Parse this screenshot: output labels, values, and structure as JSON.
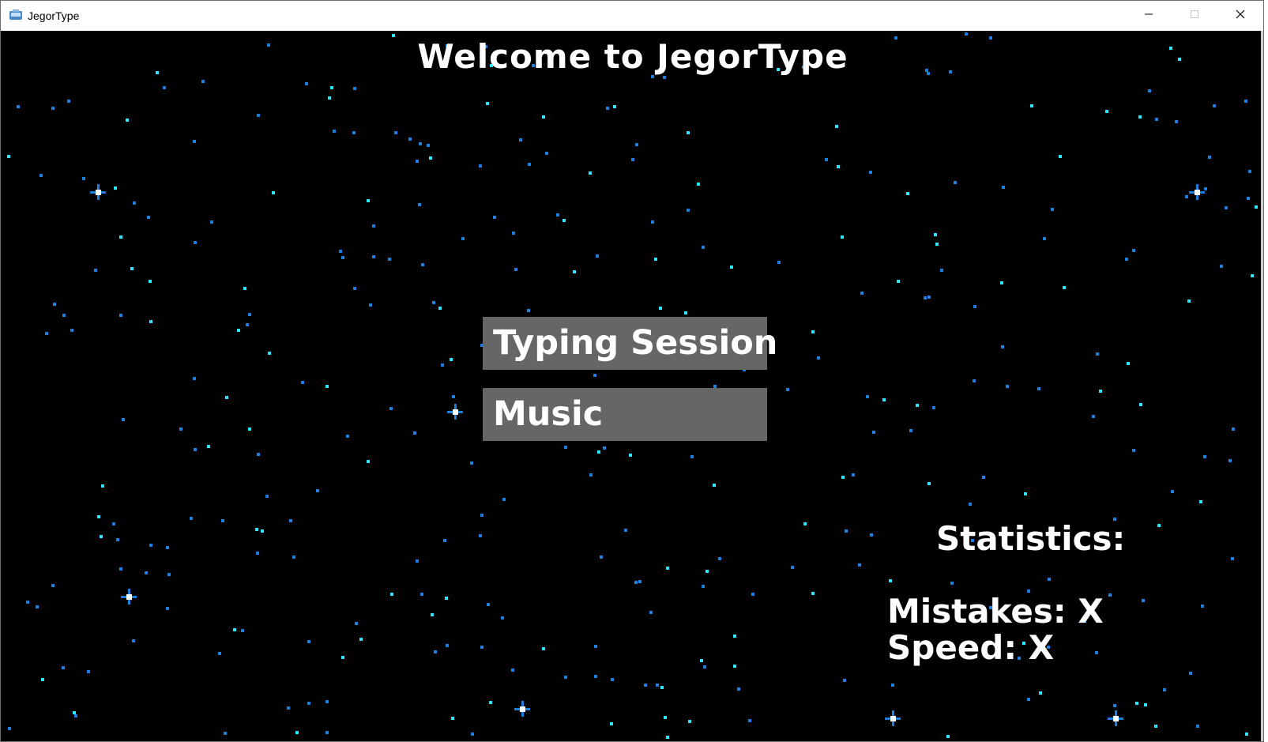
{
  "window": {
    "title": "JegorType",
    "controls": {
      "minimize": "minimize-icon",
      "maximize": "maximize-icon",
      "close": "close-icon"
    }
  },
  "main": {
    "heading": "Welcome to JegorType",
    "buttons": {
      "typing_session": "Typing Session",
      "music": "Music"
    },
    "statistics": {
      "title": "Statistics:",
      "mistakes": "Mistakes: X",
      "speed": "Speed: X"
    }
  },
  "colors": {
    "background": "#000000",
    "button": "#666666",
    "text": "#ffffff",
    "star_light": "#2ee6ff",
    "star_dark": "#1a7fe0"
  }
}
